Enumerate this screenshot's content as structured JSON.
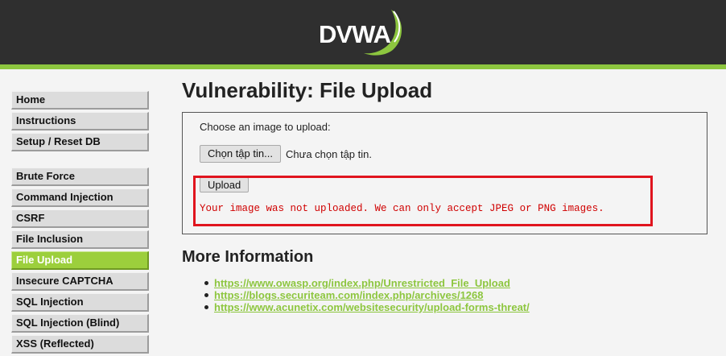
{
  "header": {
    "logo_text": "DVWA",
    "background_color": "#2f2f2f",
    "accent_color": "#8dc63f"
  },
  "sidebar": {
    "group1": [
      {
        "label": "Home"
      },
      {
        "label": "Instructions"
      },
      {
        "label": "Setup / Reset DB"
      }
    ],
    "group2": [
      {
        "label": "Brute Force"
      },
      {
        "label": "Command Injection"
      },
      {
        "label": "CSRF"
      },
      {
        "label": "File Inclusion"
      },
      {
        "label": "File Upload",
        "selected": true
      },
      {
        "label": "Insecure CAPTCHA"
      },
      {
        "label": "SQL Injection"
      },
      {
        "label": "SQL Injection (Blind)"
      },
      {
        "label": "XSS (Reflected)"
      }
    ]
  },
  "main": {
    "title": "Vulnerability: File Upload",
    "upload_form": {
      "choose_label": "Choose an image to upload:",
      "choose_button": "Chọn tập tin...",
      "no_file_text": "Chưa chọn tập tin.",
      "upload_button": "Upload",
      "error_message": "Your image was not uploaded. We can only accept JPEG or PNG images.",
      "error_color": "#d00000",
      "highlight_color": "#e0141e"
    },
    "more_info": {
      "title": "More Information",
      "links": [
        "https://www.owasp.org/index.php/Unrestricted_File_Upload",
        "https://blogs.securiteam.com/index.php/archives/1268",
        "https://www.acunetix.com/websitesecurity/upload-forms-threat/"
      ]
    }
  }
}
